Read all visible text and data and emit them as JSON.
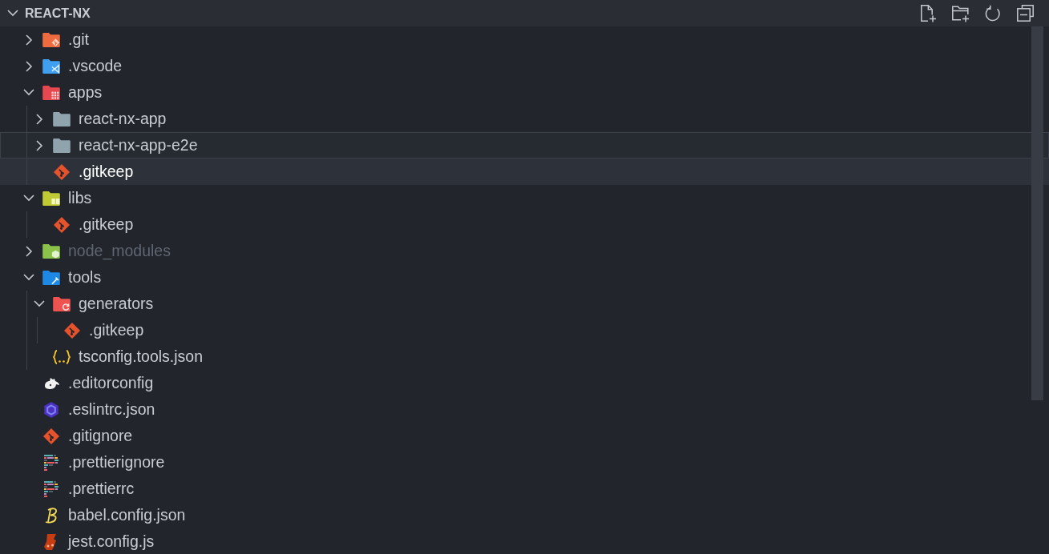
{
  "explorer": {
    "title": "REACT-NX",
    "expanded": true,
    "tree": [
      {
        "name": ".git",
        "kind": "gitfolder",
        "expanded": false,
        "selected": false,
        "focused": false,
        "ignored": false
      },
      {
        "name": ".vscode",
        "kind": "vscodefolder",
        "expanded": false,
        "selected": false,
        "focused": false,
        "ignored": false
      },
      {
        "name": "apps",
        "kind": "appsfolder",
        "expanded": true,
        "selected": false,
        "focused": false,
        "ignored": false,
        "children": [
          {
            "name": "react-nx-app",
            "kind": "folder",
            "expanded": false,
            "selected": false,
            "focused": false,
            "ignored": false
          },
          {
            "name": "react-nx-app-e2e",
            "kind": "folder",
            "expanded": false,
            "selected": false,
            "focused": true,
            "ignored": false
          },
          {
            "name": ".gitkeep",
            "kind": "git",
            "selected": true,
            "focused": false,
            "ignored": false
          }
        ]
      },
      {
        "name": "libs",
        "kind": "libsfolder",
        "expanded": true,
        "selected": false,
        "focused": false,
        "ignored": false,
        "children": [
          {
            "name": ".gitkeep",
            "kind": "git",
            "selected": false,
            "focused": false,
            "ignored": false
          }
        ]
      },
      {
        "name": "node_modules",
        "kind": "nodefolder",
        "expanded": false,
        "selected": false,
        "focused": false,
        "ignored": true
      },
      {
        "name": "tools",
        "kind": "toolsfolder",
        "expanded": true,
        "selected": false,
        "focused": false,
        "ignored": false,
        "children": [
          {
            "name": "generators",
            "kind": "generatorsfolder",
            "expanded": true,
            "selected": false,
            "focused": false,
            "ignored": false,
            "children": [
              {
                "name": ".gitkeep",
                "kind": "git",
                "selected": false,
                "focused": false,
                "ignored": false
              }
            ]
          },
          {
            "name": "tsconfig.tools.json",
            "kind": "json",
            "selected": false,
            "focused": false,
            "ignored": false
          }
        ]
      },
      {
        "name": ".editorconfig",
        "kind": "editorconfig",
        "selected": false,
        "focused": false,
        "ignored": false
      },
      {
        "name": ".eslintrc.json",
        "kind": "eslint",
        "selected": false,
        "focused": false,
        "ignored": false
      },
      {
        "name": ".gitignore",
        "kind": "git",
        "selected": false,
        "focused": false,
        "ignored": false
      },
      {
        "name": ".prettierignore",
        "kind": "prettier",
        "selected": false,
        "focused": false,
        "ignored": false
      },
      {
        "name": ".prettierrc",
        "kind": "prettier",
        "selected": false,
        "focused": false,
        "ignored": false
      },
      {
        "name": "babel.config.json",
        "kind": "babel",
        "selected": false,
        "focused": false,
        "ignored": false
      },
      {
        "name": "jest.config.js",
        "kind": "jest",
        "selected": false,
        "focused": false,
        "ignored": false
      }
    ]
  }
}
